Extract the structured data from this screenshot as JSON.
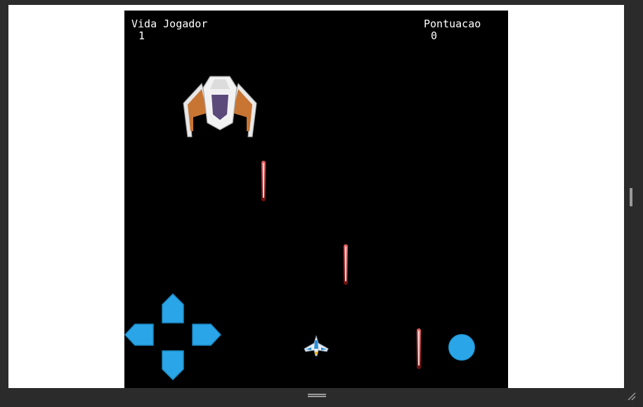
{
  "hud": {
    "life_label": "Vida Jogador",
    "life_value": "1",
    "score_label": "Pontuacao",
    "score_value": "0"
  },
  "colors": {
    "game_background": "#000000",
    "control_blue": "#2aa6e8",
    "laser_red": "#c0392b",
    "enemy_orange": "#c87533",
    "window_chrome": "#2b2b2b"
  },
  "sprites": {
    "enemy": "enemy-ship-icon",
    "player": "player-ship-icon",
    "projectile": "laser-bolt-icon"
  },
  "controls": {
    "up": "arrow-up-icon",
    "down": "arrow-down-icon",
    "left": "arrow-left-icon",
    "right": "arrow-right-icon",
    "fire": "fire-button"
  }
}
